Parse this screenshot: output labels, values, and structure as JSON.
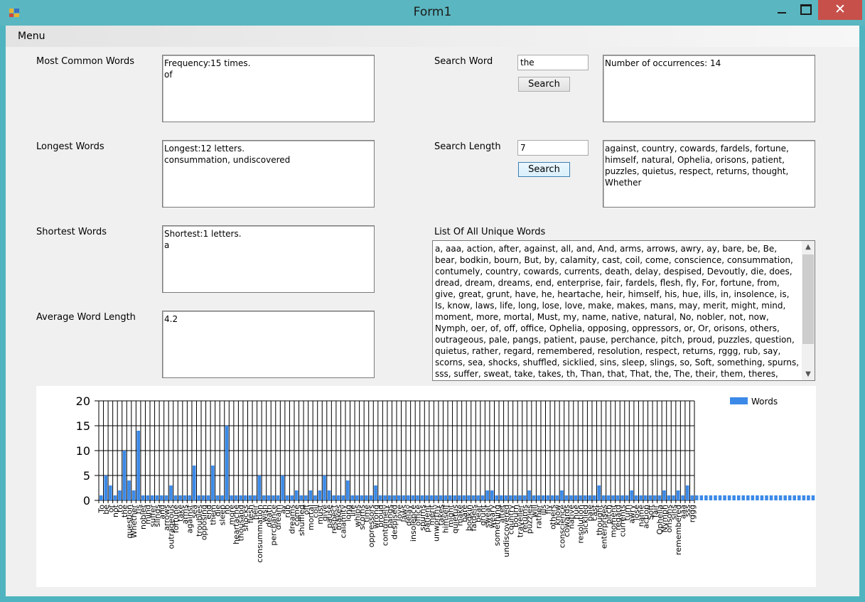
{
  "window": {
    "title": "Form1",
    "close_glyph": "✕"
  },
  "menu": {
    "items": [
      "Menu"
    ]
  },
  "labels": {
    "most_common": "Most Common Words",
    "longest": "Longest Words",
    "shortest": "Shortest Words",
    "average": "Average Word Length",
    "search_word": "Search Word",
    "search_length": "Search Length",
    "unique": "List Of All Unique Words"
  },
  "results": {
    "most_common": "Frequency:15 times.\nof",
    "longest": "Longest:12 letters.\nconsummation, undiscovered",
    "shortest": "Shortest:1 letters.\na",
    "average": "4.2",
    "occurrences": "Number of occurrences: 14",
    "length_words": "against, country, cowards, fardels, fortune, himself, natural, Ophelia, orisons, patient, puzzles, quietus, respect, returns, thought, Whether"
  },
  "search_word": {
    "value": "the",
    "button": "Search"
  },
  "search_length": {
    "value": "7",
    "button": "Search"
  },
  "unique_words": "a, aaa, action, after, against, all, and, And, arms, arrows, awry, ay, bare, be, Be, bear, bodkin, bourn, But, by, calamity, cast, coil, come, conscience, consummation, contumely, country, cowards, currents, death, delay, despised, Devoutly, die, does, dread, dream, dreams, end, enterprise, fair, fardels, flesh, fly, For, fortune, from, give, great, grunt, have, he, heartache, heir, himself, his, hue, ills, in, insolence, is, Is, know, laws, life, long, lose, love, make, makes, mans, may, merit, might, mind, moment, more, mortal, Must, my, name, native, natural, No, nobler, not, now, Nymph, oer, of, off, office, Ophelia, opposing, oppressors, or, Or, orisons, others, outrageous, pale, pangs, patient, pause, perchance, pitch, proud, puzzles, question, quietus, rather, regard, remembered, resolution, respect, returns, rggg, rub, say, scorns, sea, shocks, shuffled, sicklied, sins, sleep, slings, so, Soft, something, spurns, sss, suffer, sweat, take, takes, th, Than, that, That, the, The, their, them, theres, Theres, this, those, thought, thousand,",
  "colors": {
    "bar": "#3c8ae8",
    "titlebar": "#5ab6c0",
    "close": "#c7504b"
  },
  "chart_data": {
    "type": "bar",
    "ylim": [
      0,
      20
    ],
    "yticks": [
      0,
      5,
      10,
      15,
      20
    ],
    "legend": "top-right",
    "grid": true,
    "series": [
      {
        "name": "Words"
      }
    ],
    "categories": [
      "To",
      "be",
      "or",
      "not",
      "to",
      "the",
      "question",
      "Whether",
      "tis",
      "nobler",
      "mind",
      "suffer",
      "slings",
      "and",
      "arrows",
      "outrageous",
      "fortune",
      "take",
      "arms",
      "against",
      "sea",
      "troubles",
      "opposing",
      "end",
      "them",
      "die",
      "sleep",
      "no",
      "more",
      "heartache",
      "thousand",
      "shocks",
      "flesh",
      "heir",
      "consummation",
      "wish",
      "death",
      "perchance",
      "dream",
      "ay",
      "rub",
      "dreams",
      "come",
      "shuffled",
      "off",
      "mortal",
      "coil",
      "must",
      "give",
      "pause",
      "respect",
      "makes",
      "calamity",
      "long",
      "life",
      "whips",
      "scorns",
      "time",
      "oppressors",
      "wrong",
      "proud",
      "contumely",
      "pangs",
      "despised",
      "love",
      "laws",
      "delay",
      "insolence",
      "office",
      "spurns",
      "patient",
      "merit",
      "unworthy",
      "takes",
      "himself",
      "might",
      "quietus",
      "make",
      "bare",
      "bodkin",
      "fardels",
      "bear",
      "grunt",
      "sweat",
      "weary",
      "something",
      "after",
      "undiscovered",
      "country",
      "bourn",
      "traveller",
      "returns",
      "puzzles",
      "will",
      "rather",
      "ills",
      "fly",
      "others",
      "know",
      "conscience",
      "cowards",
      "native",
      "hue",
      "resolution",
      "sicklied",
      "pale",
      "cast",
      "thought",
      "enterprises",
      "pitch",
      "moment",
      "regard",
      "currents",
      "turn",
      "awry",
      "lose",
      "name",
      "action",
      "Soft",
      "fair",
      "Ophelia",
      "Nymph",
      "orisons",
      "sins",
      "remembered",
      "aaa",
      "sss",
      "rggg"
    ],
    "values": [
      1,
      5,
      3,
      1,
      2,
      10,
      4,
      2,
      14,
      1,
      1,
      1,
      1,
      1,
      1,
      3,
      1,
      1,
      1,
      1,
      7,
      1,
      1,
      1,
      7,
      1,
      1,
      15,
      1,
      1,
      1,
      1,
      1,
      1,
      5,
      1,
      1,
      1,
      1,
      5,
      1,
      1,
      2,
      1,
      1,
      2,
      1,
      2,
      5,
      2,
      1,
      1,
      1,
      4,
      1,
      1,
      1,
      1,
      1,
      3,
      1,
      1,
      1,
      1,
      1,
      1,
      1,
      1,
      1,
      1,
      1,
      1,
      1,
      1,
      1,
      1,
      1,
      1,
      1,
      1,
      1,
      1,
      1,
      2,
      2,
      1,
      1,
      1,
      1,
      1,
      1,
      1,
      2,
      1,
      1,
      1,
      1,
      1,
      1,
      2,
      1,
      1,
      1,
      1,
      1,
      1,
      1,
      3,
      1,
      1,
      1,
      1,
      1,
      1,
      2,
      1,
      1,
      1,
      1,
      1,
      1,
      2,
      1,
      1,
      2,
      1,
      3,
      1,
      1,
      1,
      1,
      1,
      1,
      1,
      1,
      1,
      1,
      1,
      1,
      1,
      1,
      1,
      1,
      1,
      1,
      1,
      1,
      1,
      1,
      1,
      1,
      1,
      1,
      1,
      1,
      1,
      1,
      1,
      1,
      1,
      1,
      1,
      1,
      1,
      1,
      1,
      1,
      1,
      2,
      2,
      1,
      1,
      1,
      1,
      1,
      1,
      1,
      1,
      1,
      1,
      1,
      1,
      1,
      1,
      1,
      1,
      1,
      1,
      1,
      1,
      1,
      1,
      1,
      1,
      1,
      1,
      1,
      1,
      1,
      1,
      1,
      1,
      1,
      1,
      1,
      1,
      2,
      1,
      1,
      1,
      1,
      1,
      1,
      1,
      1,
      1,
      1,
      1,
      1,
      1,
      1,
      1,
      1,
      1,
      1,
      1,
      1,
      1,
      1,
      1,
      1,
      1,
      1,
      1,
      1,
      1,
      1,
      1,
      1,
      1,
      1,
      1,
      1,
      1,
      1,
      1,
      1,
      1,
      1
    ]
  }
}
